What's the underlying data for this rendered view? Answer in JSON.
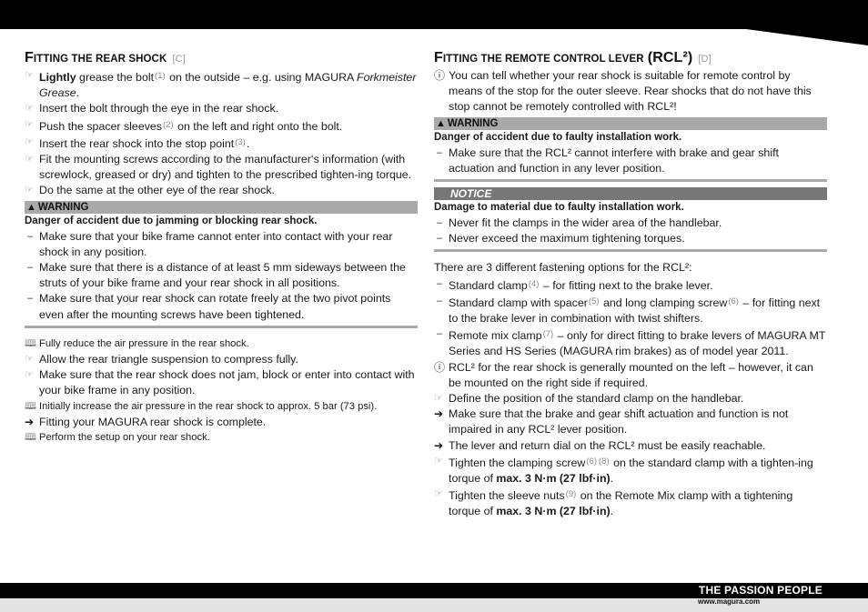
{
  "footer": {
    "slogan": "THE PASSION PEOPLE",
    "url": "www.magura.com"
  },
  "left": {
    "title_first": "F",
    "title_rest": "itting the rear shock",
    "title_ref": "[C]",
    "steps1": [
      {
        "icon": "hand-pointer-icon",
        "parts": [
          {
            "b": "Lightly"
          },
          {
            "t": " grease the bolt"
          },
          {
            "s": "(1)"
          },
          {
            "t": " on the outside – e.g. using MAGURA "
          },
          {
            "i": "Forkmeister Grease"
          },
          {
            "t": "."
          }
        ]
      },
      {
        "icon": "hand-pointer-icon",
        "parts": [
          {
            "t": "Insert the bolt through the eye in the rear shock."
          }
        ]
      },
      {
        "icon": "hand-pointer-icon",
        "parts": [
          {
            "t": "Push the spacer sleeves"
          },
          {
            "s": "(2)"
          },
          {
            "t": " on the left and right onto the bolt."
          }
        ]
      },
      {
        "icon": "hand-pointer-icon",
        "parts": [
          {
            "t": "Insert the rear shock into the stop point"
          },
          {
            "s": "(3)"
          },
          {
            "t": "."
          }
        ]
      },
      {
        "icon": "hand-pointer-icon",
        "parts": [
          {
            "t": "Fit the mounting screws according to the manufacturer‘s information (with screwlock, greased or dry) and tighten to the prescribed tighten-ing torque."
          }
        ]
      },
      {
        "icon": "hand-pointer-icon",
        "parts": [
          {
            "t": "Do the same at the other eye of the rear shock."
          }
        ]
      }
    ],
    "warning": {
      "label": "WARNING",
      "heading": "Danger of accident due to jamming or blocking rear shock.",
      "items": [
        "Make sure that your bike frame cannot enter into contact with your rear shock in any position.",
        "Make sure that there is a distance of at least 5 mm sideways between the struts of your bike frame and your rear shock in all positions.",
        "Make sure that your rear shock can rotate freely at the two pivot points even after the mounting screws have been tightened."
      ]
    },
    "steps2": [
      {
        "icon": "book-icon",
        "small": true,
        "text": "Fully reduce the air pressure in the rear shock."
      },
      {
        "icon": "hand-pointer-icon",
        "small": false,
        "text": "Allow the rear triangle suspension to compress fully."
      },
      {
        "icon": "hand-pointer-icon",
        "small": false,
        "text": "Make sure that the rear shock does not jam, block or enter into contact with your bike frame in any position."
      },
      {
        "icon": "book-icon",
        "small": true,
        "text": "Initially increase the air pressure in the rear shock to approx. 5 bar (73 psi)."
      },
      {
        "icon": "arrow-right-icon",
        "small": false,
        "text": "Fitting your MAGURA rear shock is complete."
      },
      {
        "icon": "book-icon",
        "small": true,
        "text": "Perform the setup on your rear shock."
      }
    ]
  },
  "right": {
    "title_first": "F",
    "title_rest": "itting the remote control lever",
    "title_rcl": "(RCL²)",
    "title_ref": "[D]",
    "intro_info": "You can tell whether your rear shock is suitable for remote control by means of the stop for the outer sleeve. Rear shocks that do not have this stop cannot be remotely controlled with RCL²!",
    "warning": {
      "label": "WARNING",
      "heading": "Danger of accident due to faulty installation work.",
      "items": [
        "Make sure that the RCL² cannot interfere with brake and gear shift actuation and function in any lever position."
      ]
    },
    "notice": {
      "label": "NOTICE",
      "heading": "Damage to material due to faulty installation work.",
      "items": [
        "Never fit the clamps in the wider area of the handlebar.",
        "Never exceed the maximum tightening torques."
      ]
    },
    "options_intro": "There are 3 different fastening options for the RCL²:",
    "options": [
      [
        {
          "t": "Standard clamp"
        },
        {
          "s": "(4)"
        },
        {
          "t": " – for fitting next to the brake lever."
        }
      ],
      [
        {
          "t": "Standard clamp with spacer"
        },
        {
          "s": "(5)"
        },
        {
          "t": " and long clamping screw"
        },
        {
          "s": "(6)"
        },
        {
          "t": " – for fitting next to the brake lever in combination with twist shifters."
        }
      ],
      [
        {
          "t": "Remote mix clamp"
        },
        {
          "s": "(7)"
        },
        {
          "t": " – only for direct fitting to brake levers of MAGURA MT Series and HS Series (MAGURA rim brakes) as of model year 2011."
        }
      ]
    ],
    "steps": [
      {
        "icon": "info-icon",
        "parts": [
          {
            "t": "RCL² for the rear shock is generally mounted on the left – however, it can be mounted on the right side if required."
          }
        ]
      },
      {
        "icon": "hand-pointer-icon",
        "parts": [
          {
            "t": "Define the position of the standard clamp on the handlebar."
          }
        ]
      },
      {
        "icon": "arrow-right-icon",
        "parts": [
          {
            "t": "Make sure that the brake and gear shift actuation and function is not impaired in any RCL² lever position."
          }
        ]
      },
      {
        "icon": "arrow-right-icon",
        "parts": [
          {
            "t": "The lever and return dial on the RCL² must be easily reachable."
          }
        ]
      },
      {
        "icon": "hand-pointer-icon",
        "parts": [
          {
            "t": "Tighten the clamping screw"
          },
          {
            "s": "(6)"
          },
          {
            "s": "(8)"
          },
          {
            "t": " on the standard clamp with a tighten-ing torque of "
          },
          {
            "b": "max. 3 N·m (27 lbf·in)"
          },
          {
            "t": "."
          }
        ]
      },
      {
        "icon": "hand-pointer-icon",
        "parts": [
          {
            "t": "Tighten the sleeve nuts"
          },
          {
            "s": "(9)"
          },
          {
            "t": " on the Remote Mix clamp with a tightening torque of "
          },
          {
            "b": "max. 3 N·m (27 lbf·in)"
          },
          {
            "t": "."
          }
        ]
      }
    ]
  }
}
